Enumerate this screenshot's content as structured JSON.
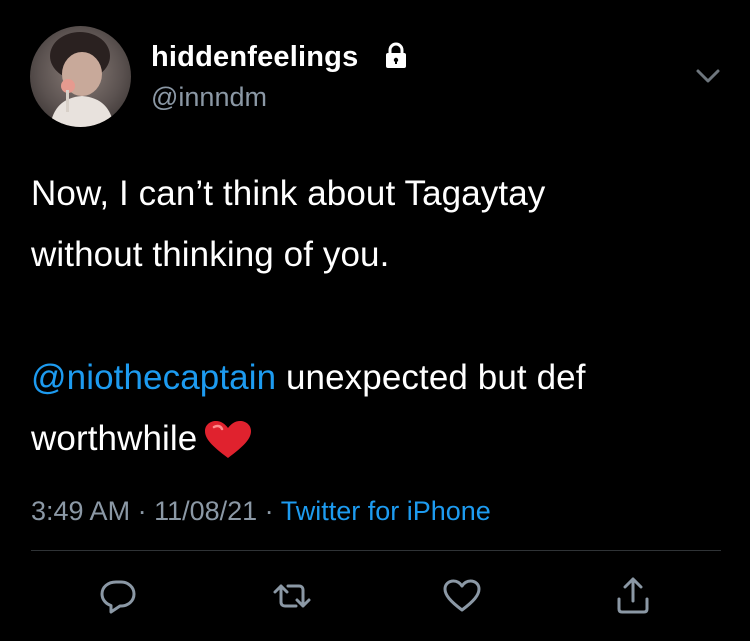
{
  "tweet": {
    "author": {
      "display_name": "hiddenfeelings",
      "handle": "@innndm",
      "protected_icon": "lock-icon",
      "avatar_icon": "avatar"
    },
    "text_lines": [
      "Now, I can’t think about Tagaytay",
      "without thinking of you."
    ],
    "reply": {
      "mention": "@niothecaptain",
      "rest_line1": " unexpected but def",
      "line2": "worthwhile",
      "emoji": "heart-emoji"
    },
    "meta": {
      "time": "3:49 AM",
      "separator": " · ",
      "date": "11/08/21",
      "source": "Twitter for iPhone"
    },
    "actions": [
      "reply-icon",
      "retweet-icon",
      "like-icon",
      "share-icon"
    ],
    "menu_icon": "chevron-down-icon"
  },
  "colors": {
    "background": "#000000",
    "text": "#ffffff",
    "secondary": "#8b98a5",
    "accent": "#1d9bf0",
    "heart": "#e0222e"
  }
}
